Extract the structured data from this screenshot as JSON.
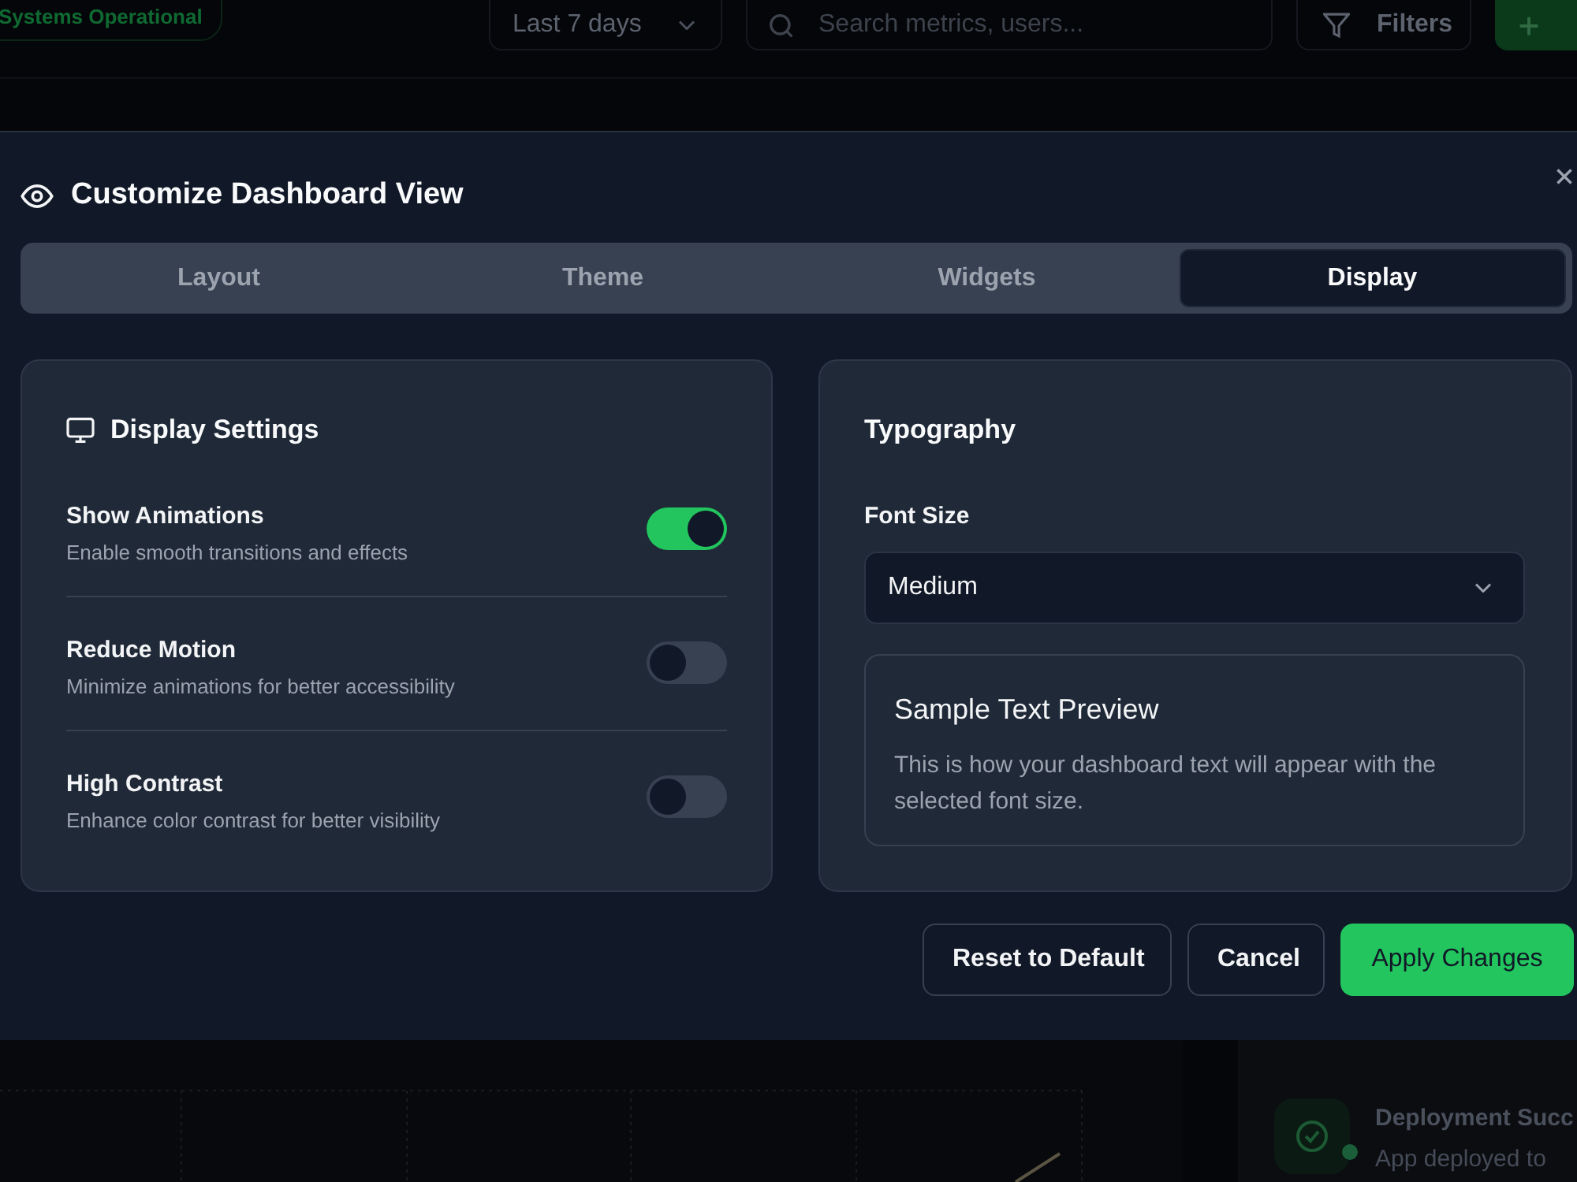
{
  "backdrop": {
    "status_badge": "Systems Operational",
    "date_range": {
      "value": "Last 7 days"
    },
    "search": {
      "placeholder": "Search metrics, users..."
    },
    "filters_button": "Filters",
    "notification": {
      "title": "Deployment Succ",
      "message": "App deployed to"
    }
  },
  "dialog": {
    "title": "Customize Dashboard View",
    "tabs": [
      {
        "label": "Layout",
        "selected": false
      },
      {
        "label": "Theme",
        "selected": false
      },
      {
        "label": "Widgets",
        "selected": false
      },
      {
        "label": "Display",
        "selected": true
      }
    ],
    "display_settings": {
      "title": "Display Settings",
      "settings": [
        {
          "label": "Show Animations",
          "description": "Enable smooth transitions and effects",
          "on": true
        },
        {
          "label": "Reduce Motion",
          "description": "Minimize animations for better accessibility",
          "on": false
        },
        {
          "label": "High Contrast",
          "description": "Enhance color contrast for better visibility",
          "on": false
        }
      ]
    },
    "typography": {
      "title": "Typography",
      "font_size": {
        "label": "Font Size",
        "value": "Medium"
      },
      "preview": {
        "title": "Sample Text Preview",
        "text": "This is how your dashboard text will appear with the selected font size."
      }
    },
    "buttons": [
      {
        "label": "Reset to Default",
        "kind": "secondary"
      },
      {
        "label": "Cancel",
        "kind": "secondary"
      },
      {
        "label": "Apply Changes",
        "kind": "primary"
      }
    ]
  }
}
